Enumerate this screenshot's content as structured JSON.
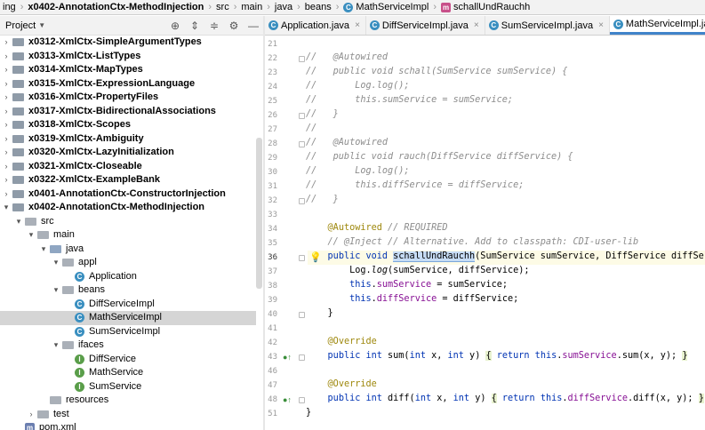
{
  "navbar": {
    "project_partial": "ing",
    "module": "x0402-AnnotationCtx-MethodInjection",
    "path": [
      "src",
      "main",
      "java",
      "beans"
    ],
    "class_name": "MathServiceImpl",
    "method_name": "schallUndRauchh"
  },
  "project_panel": {
    "title": "Project",
    "dropdown_icon": "chevron-down-icon",
    "tools": [
      "target-icon",
      "expand-icon",
      "collapse-icon",
      "gear-icon",
      "minimize-icon"
    ],
    "tree": [
      {
        "label": "x0312-XmlCtx-SimpleArgumentTypes",
        "level": 0,
        "kind": "module",
        "arrow": "closed"
      },
      {
        "label": "x0313-XmlCtx-ListTypes",
        "level": 0,
        "kind": "module",
        "arrow": "closed"
      },
      {
        "label": "x0314-XmlCtx-MapTypes",
        "level": 0,
        "kind": "module",
        "arrow": "closed"
      },
      {
        "label": "x0315-XmlCtx-ExpressionLanguage",
        "level": 0,
        "kind": "module",
        "arrow": "closed"
      },
      {
        "label": "x0316-XmlCtx-PropertyFiles",
        "level": 0,
        "kind": "module",
        "arrow": "closed"
      },
      {
        "label": "x0317-XmlCtx-BidirectionalAssociations",
        "level": 0,
        "kind": "module",
        "arrow": "closed"
      },
      {
        "label": "x0318-XmlCtx-Scopes",
        "level": 0,
        "kind": "module",
        "arrow": "closed"
      },
      {
        "label": "x0319-XmlCtx-Ambiguity",
        "level": 0,
        "kind": "module",
        "arrow": "closed"
      },
      {
        "label": "x0320-XmlCtx-LazyInitialization",
        "level": 0,
        "kind": "module",
        "arrow": "closed"
      },
      {
        "label": "x0321-XmlCtx-Closeable",
        "level": 0,
        "kind": "module",
        "arrow": "closed"
      },
      {
        "label": "x0322-XmlCtx-ExampleBank",
        "level": 0,
        "kind": "module",
        "arrow": "closed"
      },
      {
        "label": "x0401-AnnotationCtx-ConstructorInjection",
        "level": 0,
        "kind": "module",
        "arrow": "closed"
      },
      {
        "label": "x0402-AnnotationCtx-MethodInjection",
        "level": 0,
        "kind": "module",
        "arrow": "open"
      },
      {
        "label": "src",
        "level": 1,
        "kind": "folder",
        "arrow": "open"
      },
      {
        "label": "main",
        "level": 2,
        "kind": "folder",
        "arrow": "open"
      },
      {
        "label": "java",
        "level": 3,
        "kind": "srcfolder",
        "arrow": "open"
      },
      {
        "label": "appl",
        "level": 4,
        "kind": "package",
        "arrow": "open"
      },
      {
        "label": "Application",
        "level": 5,
        "kind": "class",
        "arrow": "none"
      },
      {
        "label": "beans",
        "level": 4,
        "kind": "package",
        "arrow": "open"
      },
      {
        "label": "DiffServiceImpl",
        "level": 5,
        "kind": "class",
        "arrow": "none"
      },
      {
        "label": "MathServiceImpl",
        "level": 5,
        "kind": "class",
        "arrow": "none",
        "selected": true
      },
      {
        "label": "SumServiceImpl",
        "level": 5,
        "kind": "class",
        "arrow": "none"
      },
      {
        "label": "ifaces",
        "level": 4,
        "kind": "package",
        "arrow": "open"
      },
      {
        "label": "DiffService",
        "level": 5,
        "kind": "iface",
        "arrow": "none"
      },
      {
        "label": "MathService",
        "level": 5,
        "kind": "iface",
        "arrow": "none"
      },
      {
        "label": "SumService",
        "level": 5,
        "kind": "iface",
        "arrow": "none"
      },
      {
        "label": "resources",
        "level": 3,
        "kind": "folder",
        "arrow": "none"
      },
      {
        "label": "test",
        "level": 2,
        "kind": "folder",
        "arrow": "closed"
      },
      {
        "label": "pom.xml",
        "level": 1,
        "kind": "pom",
        "arrow": "none"
      }
    ]
  },
  "tabs": [
    {
      "label": "Application.java",
      "active": false
    },
    {
      "label": "DiffServiceImpl.java",
      "active": false
    },
    {
      "label": "SumServiceImpl.java",
      "active": false
    },
    {
      "label": "MathServiceImpl.java",
      "active": true
    }
  ],
  "tab_close_glyph": "×",
  "editor": {
    "current_line": 36,
    "lines": [
      {
        "n": "21",
        "html": ""
      },
      {
        "n": "22",
        "html": "<span class=\"cmt\">//   @Autowired</span>"
      },
      {
        "n": "23",
        "html": "<span class=\"cmt\">//   public void schall(SumService sumService) {</span>"
      },
      {
        "n": "24",
        "html": "<span class=\"cmt\">//       Log.log();</span>"
      },
      {
        "n": "25",
        "html": "<span class=\"cmt\">//       this.sumService = sumService;</span>"
      },
      {
        "n": "26",
        "html": "<span class=\"cmt\">//   }</span>"
      },
      {
        "n": "27",
        "html": "<span class=\"cmt\">//</span>"
      },
      {
        "n": "28",
        "html": "<span class=\"cmt\">//   @Autowired</span>"
      },
      {
        "n": "29",
        "html": "<span class=\"cmt\">//   public void rauch(DiffService diffService) {</span>"
      },
      {
        "n": "30",
        "html": "<span class=\"cmt\">//       Log.log();</span>"
      },
      {
        "n": "31",
        "html": "<span class=\"cmt\">//       this.diffService = diffService;</span>"
      },
      {
        "n": "32",
        "html": "<span class=\"cmt\">//   }</span>"
      },
      {
        "n": "33",
        "html": ""
      },
      {
        "n": "34",
        "html": "    <span class=\"ann\">@Autowired</span> <span class=\"cmt\">// REQUIRED</span>"
      },
      {
        "n": "35",
        "html": "    <span class=\"cmt\">// @Inject // Alternative. Add to classpath: CDI-user-lib</span>"
      },
      {
        "n": "36",
        "html": "    <span class=\"kw\">public void</span> <span class=\"fn-hl\">schallUndRauchh</span>(SumService sumService, DiffService diffService) {"
      },
      {
        "n": "37",
        "html": "        Log.<i>log</i>(sumService, diffService);"
      },
      {
        "n": "38",
        "html": "        <span class=\"kw\">this</span>.<span class=\"fld\">sumService</span> = sumService;"
      },
      {
        "n": "39",
        "html": "        <span class=\"kw\">this</span>.<span class=\"fld\">diffService</span> = diffService;"
      },
      {
        "n": "40",
        "html": "    }"
      },
      {
        "n": "41",
        "html": ""
      },
      {
        "n": "42",
        "html": "    <span class=\"ann\">@Override</span>"
      },
      {
        "n": "43",
        "html": "    <span class=\"kw\">public int</span> sum(<span class=\"kw\">int</span> x, <span class=\"kw\">int</span> y) <span class=\"brace-hl\">{</span> <span class=\"kw\">return this</span>.<span class=\"fld\">sumService</span>.sum(x, y); <span class=\"brace-hl\">}</span>"
      },
      {
        "n": "46",
        "html": ""
      },
      {
        "n": "47",
        "html": "    <span class=\"ann\">@Override</span>"
      },
      {
        "n": "48",
        "html": "    <span class=\"kw\">public int</span> diff(<span class=\"kw\">int</span> x, <span class=\"kw\">int</span> y) <span class=\"brace-hl\">{</span> <span class=\"kw\">return this</span>.<span class=\"fld\">diffService</span>.diff(x, y); <span class=\"brace-hl\">}</span>"
      },
      {
        "n": "51",
        "html": "}"
      }
    ]
  }
}
